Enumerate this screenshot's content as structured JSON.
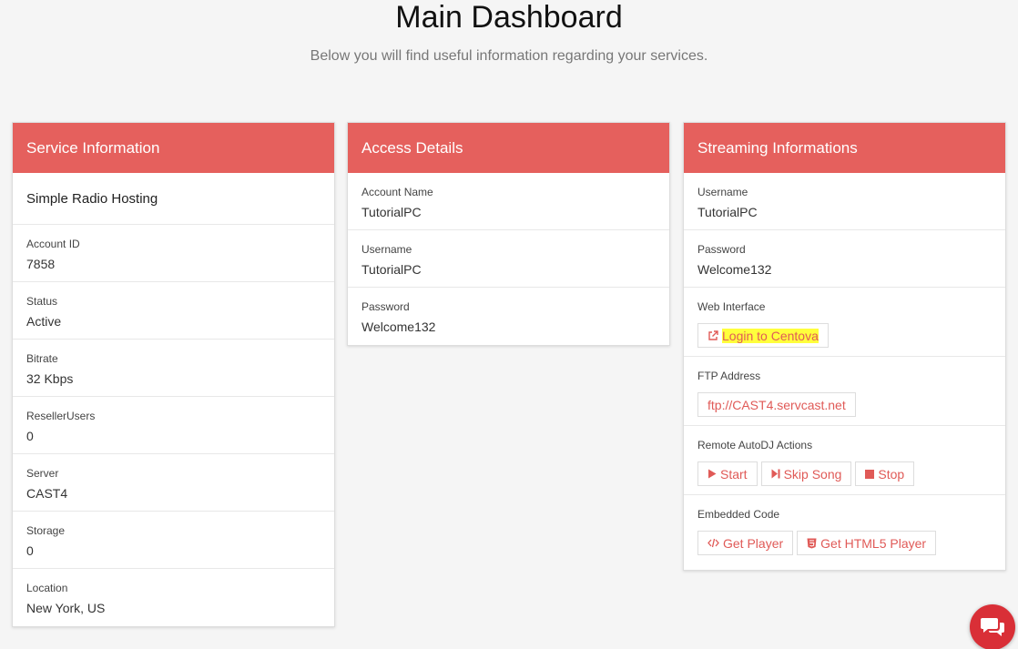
{
  "header": {
    "title": "Main Dashboard",
    "subtitle": "Below you will find useful information regarding your services."
  },
  "service": {
    "heading": "Service Information",
    "plan": "Simple Radio Hosting",
    "fields": [
      {
        "label": "Account ID",
        "value": "7858"
      },
      {
        "label": "Status",
        "value": "Active"
      },
      {
        "label": "Bitrate",
        "value": "32 Kbps"
      },
      {
        "label": "ResellerUsers",
        "value": "0"
      },
      {
        "label": "Server",
        "value": "CAST4"
      },
      {
        "label": "Storage",
        "value": "0"
      },
      {
        "label": "Location",
        "value": "New York, US"
      }
    ]
  },
  "access": {
    "heading": "Access Details",
    "fields": [
      {
        "label": "Account Name",
        "value": "TutorialPC"
      },
      {
        "label": "Username",
        "value": "TutorialPC"
      },
      {
        "label": "Password",
        "value": "Welcome132"
      }
    ]
  },
  "streaming": {
    "heading": "Streaming Informations",
    "username_label": "Username",
    "username": "TutorialPC",
    "password_label": "Password",
    "password": "Welcome132",
    "web_interface_label": "Web Interface",
    "login_button": "Login to Centova",
    "ftp_label": "FTP Address",
    "ftp_address": "ftp://CAST4.servcast.net",
    "autodj_label": "Remote AutoDJ Actions",
    "start_button": "Start",
    "skip_button": "Skip Song",
    "stop_button": "Stop",
    "embed_label": "Embedded Code",
    "get_player_button": "Get Player",
    "get_html5_button": "Get HTML5 Player"
  },
  "colors": {
    "accent": "#e5605d",
    "link": "#e05a57",
    "highlight": "#ffff3c",
    "chat": "#d92f37"
  },
  "icons": {
    "login": "external-link-icon",
    "start": "play-icon",
    "skip": "skip-forward-icon",
    "stop": "stop-icon",
    "player": "code-icon",
    "html5": "html5-icon",
    "chat": "chat-icon"
  }
}
